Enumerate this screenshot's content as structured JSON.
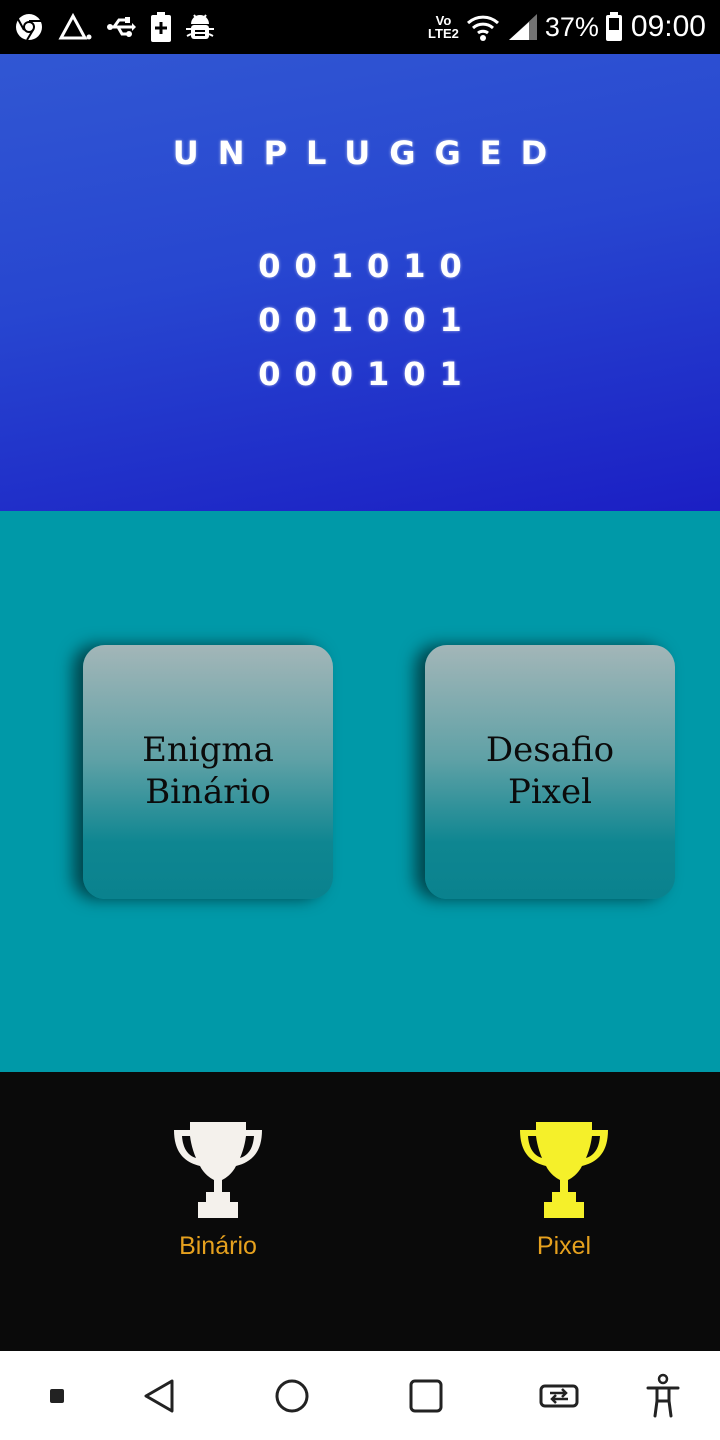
{
  "status_bar": {
    "icons_left": [
      "chrome-icon",
      "signal-triangle-icon",
      "usb-icon",
      "battery-plus-icon",
      "android-debug-icon"
    ],
    "volte_top": "Vo",
    "volte_bottom": "LTE2",
    "icons_right": [
      "wifi-icon",
      "cell-signal-icon",
      "battery-icon"
    ],
    "battery_percent": "37%",
    "time": "09:00"
  },
  "header": {
    "title": "UNPLUGGED",
    "binary_lines": [
      "001010",
      "001001",
      "000101"
    ],
    "gradient": [
      "#3157d3",
      "#1b1fc4"
    ]
  },
  "main": {
    "background": "#0099a8",
    "cards": [
      {
        "line1": "Enigma",
        "line2": "Binário"
      },
      {
        "line1": "Desafio",
        "line2": "Pixel"
      }
    ]
  },
  "trophies": [
    {
      "label": "Binário",
      "icon": "trophy-icon",
      "color": "#f4f1ec"
    },
    {
      "label": "Pixel",
      "icon": "trophy-icon",
      "color": "#f5f02a"
    }
  ],
  "nav_bar": {
    "buttons": [
      "menu-square-icon",
      "back-icon",
      "home-icon",
      "recents-icon",
      "rotate-screen-icon",
      "accessibility-icon"
    ]
  }
}
